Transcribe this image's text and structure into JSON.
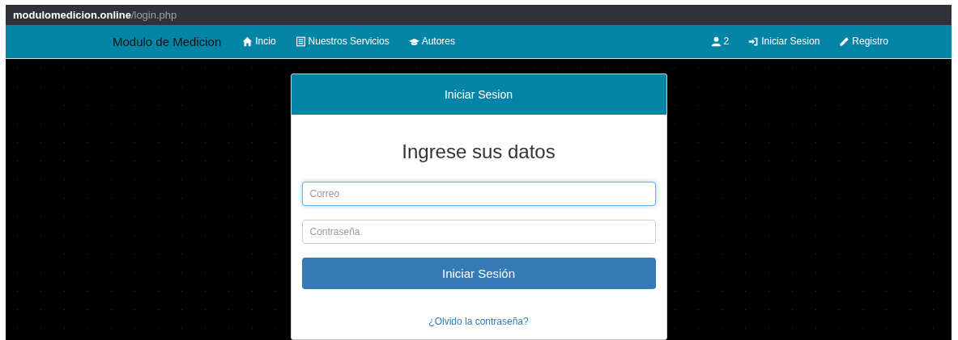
{
  "address_bar": {
    "url": "**modulomedicion.online**/login.php"
  },
  "navbar": {
    "brand": "Modulo de Medicion",
    "left_items": [
      {
        "label": "Incio"
      },
      {
        "label": "Nuestros Servicios"
      },
      {
        "label": "Autores"
      }
    ],
    "right_items": [
      {
        "label": "2"
      },
      {
        "label": "Iniciar Sesion"
      },
      {
        "label": "Registro"
      }
    ]
  },
  "login_card": {
    "header": "Iniciar Sesion",
    "heading": "Ingrese sus datos",
    "fields": [
      {
        "placeholder": "Correo",
        "focused": true
      },
      {
        "placeholder": "Contraseña",
        "focused": false
      }
    ],
    "submit": "Iniciar Sesión",
    "forgot_link": "¿Olvido la contraseña?"
  }
}
